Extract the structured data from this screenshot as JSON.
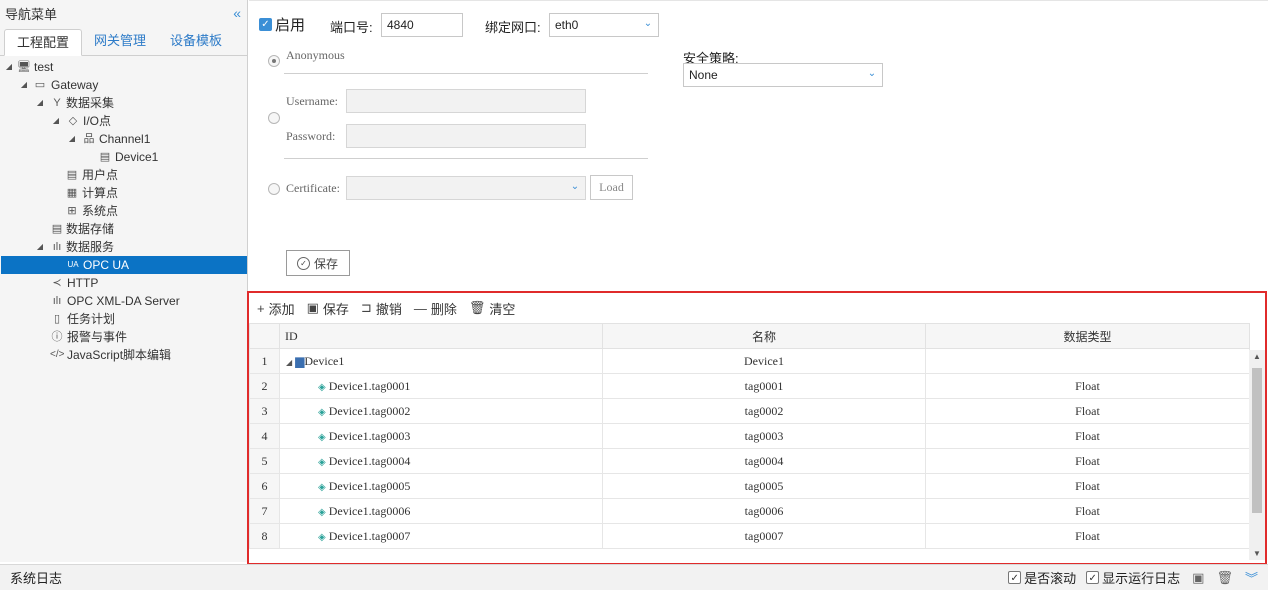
{
  "sidebar": {
    "title": "导航菜单",
    "collapse_icon": "double-chevron-left-icon",
    "tabs": [
      "工程配置",
      "网关管理",
      "设备模板"
    ],
    "tree": [
      {
        "label": "test",
        "icon": "monitor-icon"
      },
      {
        "label": "Gateway",
        "icon": "computer-icon"
      },
      {
        "label": "数据采集",
        "icon": "branch-icon"
      },
      {
        "label": "I/O点",
        "icon": "tag-icon"
      },
      {
        "label": "Channel1",
        "icon": "network-icon"
      },
      {
        "label": "Device1",
        "icon": "device-card-icon"
      },
      {
        "label": "用户点",
        "icon": "list-icon"
      },
      {
        "label": "计算点",
        "icon": "calculator-icon"
      },
      {
        "label": "系统点",
        "icon": "grid-icon"
      },
      {
        "label": "数据存储",
        "icon": "database-icon"
      },
      {
        "label": "数据服务",
        "icon": "chart-icon"
      },
      {
        "label": "OPC UA",
        "icon": "opcua-icon"
      },
      {
        "label": "HTTP",
        "icon": "share-icon"
      },
      {
        "label": "OPC XML-DA Server",
        "icon": "chart-icon"
      },
      {
        "label": "任务计划",
        "icon": "document-icon"
      },
      {
        "label": "报警与事件",
        "icon": "alert-circle-icon"
      },
      {
        "label": "JavaScript脚本编辑",
        "icon": "code-icon"
      }
    ]
  },
  "form": {
    "enable_label": "启用",
    "port_label": "端口号:",
    "port_value": "4840",
    "bind_label": "绑定网口:",
    "bind_value": "eth0",
    "security_label": "安全策略:",
    "security_value": "None",
    "anonymous_label": "Anonymous",
    "username_label": "Username:",
    "password_label": "Password:",
    "certificate_label": "Certificate:",
    "load_label": "Load",
    "save_label": "保存"
  },
  "grid": {
    "toolbar": [
      "添加",
      "保存",
      "撤销",
      "删除",
      "清空"
    ],
    "columns": [
      "ID",
      "名称",
      "数据类型"
    ],
    "rows": [
      {
        "num": "1",
        "id": "Device1",
        "name": "Device1",
        "type": ""
      },
      {
        "num": "2",
        "id": "Device1.tag0001",
        "name": "tag0001",
        "type": "Float"
      },
      {
        "num": "3",
        "id": "Device1.tag0002",
        "name": "tag0002",
        "type": "Float"
      },
      {
        "num": "4",
        "id": "Device1.tag0003",
        "name": "tag0003",
        "type": "Float"
      },
      {
        "num": "5",
        "id": "Device1.tag0004",
        "name": "tag0004",
        "type": "Float"
      },
      {
        "num": "6",
        "id": "Device1.tag0005",
        "name": "tag0005",
        "type": "Float"
      },
      {
        "num": "7",
        "id": "Device1.tag0006",
        "name": "tag0006",
        "type": "Float"
      },
      {
        "num": "8",
        "id": "Device1.tag0007",
        "name": "tag0007",
        "type": "Float"
      }
    ]
  },
  "status": {
    "title": "系统日志",
    "autoscroll_label": "是否滚动",
    "showlog_label": "显示运行日志"
  },
  "colors": {
    "accent": "#3b8fd6",
    "selected": "#0b73c5",
    "highlight_border": "#e02b2b"
  }
}
